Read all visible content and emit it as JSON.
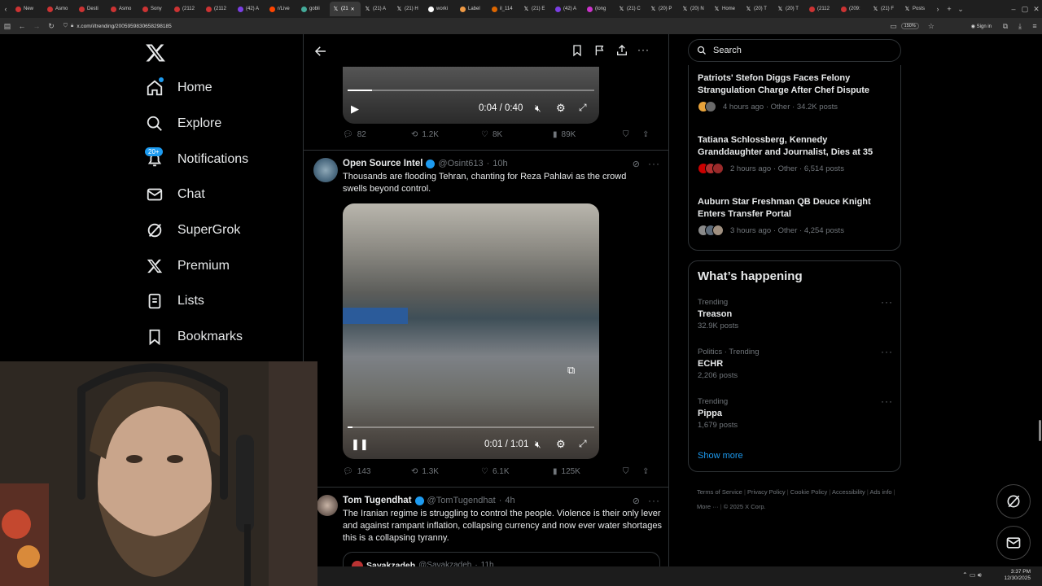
{
  "browser": {
    "tabs": [
      {
        "label": "New",
        "fav": "#c33"
      },
      {
        "label": "Asmo",
        "fav": "#c33"
      },
      {
        "label": "Desti",
        "fav": "#c33"
      },
      {
        "label": "Asmo",
        "fav": "#c33"
      },
      {
        "label": "Sony",
        "fav": "#c33"
      },
      {
        "label": "(2112",
        "fav": "#c33"
      },
      {
        "label": "(2112",
        "fav": "#c33"
      },
      {
        "label": "(42) A",
        "fav": "#7b3fe4"
      },
      {
        "label": "r/Live",
        "fav": "#ff4500"
      },
      {
        "label": "gobli",
        "fav": "#4a9"
      },
      {
        "label": "(21",
        "fav": "x",
        "active": true
      },
      {
        "label": "(21) A",
        "fav": "x"
      },
      {
        "label": "(21) H",
        "fav": "x"
      },
      {
        "label": "worki",
        "fav": "#fff"
      },
      {
        "label": "Label",
        "fav": "#e94"
      },
      {
        "label": "il_114",
        "fav": "#d60"
      },
      {
        "label": "(21) E",
        "fav": "x"
      },
      {
        "label": "(42) A",
        "fav": "#7b3fe4"
      },
      {
        "label": "(long",
        "fav": "#c3c"
      },
      {
        "label": "(21) C",
        "fav": "x"
      },
      {
        "label": "(20) P",
        "fav": "x"
      },
      {
        "label": "(20) N",
        "fav": "x"
      },
      {
        "label": "Home",
        "fav": "x"
      },
      {
        "label": "(20) T",
        "fav": "x"
      },
      {
        "label": "(20) T",
        "fav": "x"
      },
      {
        "label": "(2112",
        "fav": "#c33"
      },
      {
        "label": "(209:",
        "fav": "#c33"
      },
      {
        "label": "(21) F",
        "fav": "x"
      },
      {
        "label": "Posts",
        "fav": "x"
      }
    ],
    "url": "x.com/i/trending/2005959830658298185",
    "zoom": "150%",
    "signin": "Sign in"
  },
  "nav": {
    "home": "Home",
    "explore": "Explore",
    "notifications": "Notifications",
    "notif_badge": "20+",
    "chat": "Chat",
    "supergrok": "SuperGrok",
    "premium": "Premium",
    "lists": "Lists",
    "bookmarks": "Bookmarks"
  },
  "feed": {
    "top_video": {
      "time": "0:04 / 0:40",
      "progress": 0.1,
      "replies": "82",
      "reposts": "1.2K",
      "likes": "8K",
      "views": "89K"
    },
    "tweet1": {
      "name": "Open Source Intel",
      "handle": "@Osint613",
      "age": "10h",
      "text": "Thousands are flooding Tehran, chanting for Reza Pahlavi as the crowd swells beyond control.",
      "video_time": "0:01 / 1:01",
      "progress": 0.02,
      "replies": "143",
      "reposts": "1.3K",
      "likes": "6.1K",
      "views": "125K"
    },
    "tweet2": {
      "name": "Tom Tugendhat",
      "handle": "@TomTugendhat",
      "age": "4h",
      "text": "The Iranian regime is struggling to control the people. Violence is their only lever and against rampant inflation, collapsing currency and now ever water shortages this is a collapsing tyranny.",
      "quote_name": "Savakzadeh",
      "quote_handle": "@Savakzadeh",
      "quote_age": "11h"
    }
  },
  "right": {
    "search_placeholder": "Search",
    "news": [
      {
        "title": "Patriots' Stefon Diggs Faces Felony Strangulation Charge After Chef Dispute",
        "meta": "4 hours ago · Other · 34.2K posts",
        "avatars": [
          "#e8a33b",
          "#6a6a6a"
        ]
      },
      {
        "title": "Tatiana Schlossberg, Kennedy Granddaughter and Journalist, Dies at 35",
        "meta": "2 hours ago · Other · 6,514 posts",
        "avatars": [
          "#cc0000",
          "#b03030",
          "#9a2a2a"
        ]
      },
      {
        "title": "Auburn Star Freshman QB Deuce Knight Enters Transfer Portal",
        "meta": "3 hours ago · Other · 4,254 posts",
        "avatars": [
          "#8a8a8a",
          "#5d6b7a",
          "#a09080"
        ]
      }
    ],
    "happening_title": "What’s happening",
    "trends": [
      {
        "label": "Trending",
        "title": "Treason",
        "count": "32.9K posts"
      },
      {
        "label": "Politics · Trending",
        "title": "ECHR",
        "count": "2,206 posts"
      },
      {
        "label": "Trending",
        "title": "Pippa",
        "count": "1,679 posts"
      }
    ],
    "show_more": "Show more",
    "footer": [
      "Terms of Service",
      "Privacy Policy",
      "Cookie Policy",
      "Accessibility",
      "Ads info",
      "More ···",
      "© 2025 X Corp."
    ]
  },
  "taskbar": {
    "time": "3:37 PM",
    "date": "12/30/2025"
  },
  "colors": {
    "accent": "#1d9bf0",
    "border": "#2f3336",
    "muted": "#71767b"
  }
}
